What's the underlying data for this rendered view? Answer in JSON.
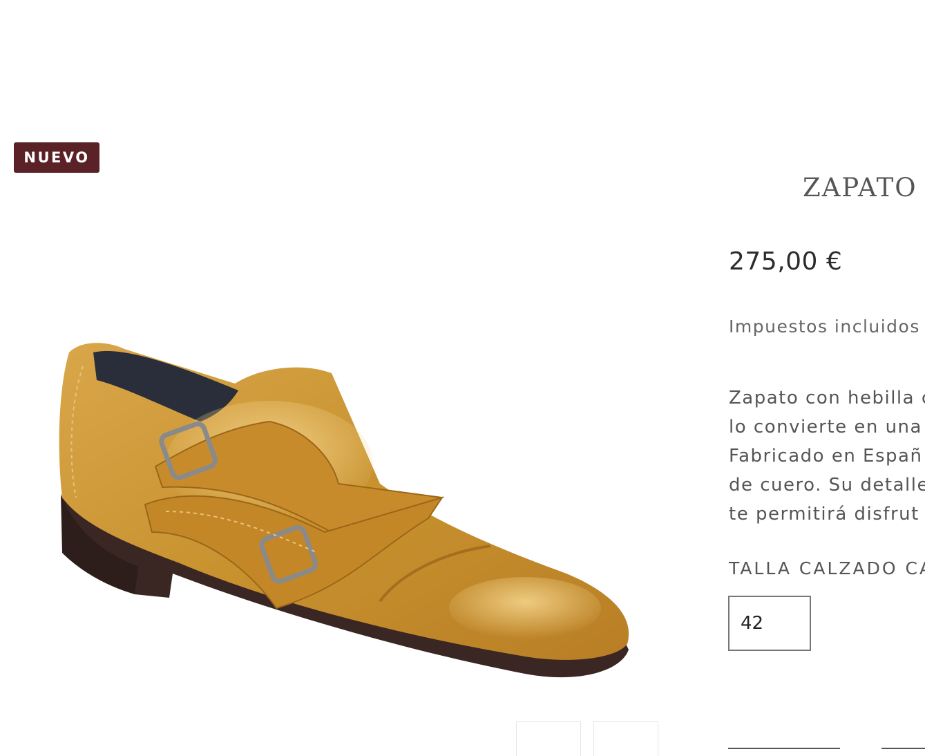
{
  "badge": {
    "label": "NUEVO",
    "color": "#5a2127"
  },
  "product": {
    "title": "ZAPATO C",
    "price": "275,00 €",
    "tax_note": "Impuestos incluidos",
    "description_lines": [
      "Zapato con hebilla c",
      "lo convierte en una",
      "Fabricado en Españ",
      "de cuero. Su detalle",
      "te permitirá disfrut"
    ],
    "image_icon": "monk-strap-shoe-image"
  },
  "size": {
    "label": "TALLA CALZADO CA",
    "selected": "42"
  },
  "thumbnails": [
    {
      "icon": "thumbnail-image"
    },
    {
      "icon": "thumbnail-image"
    }
  ]
}
